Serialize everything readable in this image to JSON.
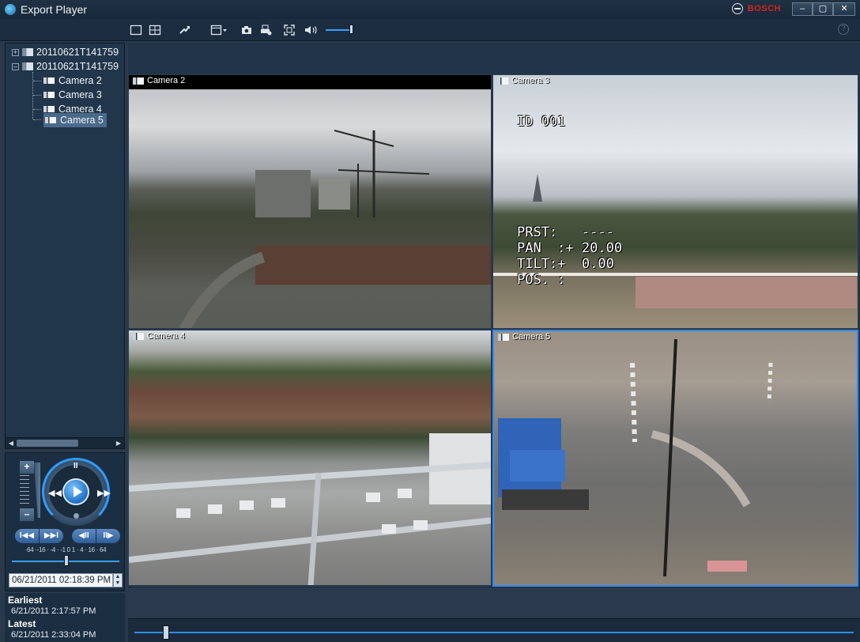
{
  "window": {
    "title": "Export Player",
    "brand": "BOSCH",
    "minimize": "–",
    "maximize": "▢",
    "close": "✕"
  },
  "colors": {
    "accent": "#2f8bff",
    "brand_red": "#d8241f",
    "panel": "#22364b",
    "window_bg": "#2a3a4c"
  },
  "toolbar": {
    "icons": [
      "single-view-icon",
      "quad-view-icon",
      "export-icon",
      "display-options-icon",
      "snapshot-icon",
      "print-icon",
      "fullscreen-icon",
      "speaker-icon"
    ],
    "volume_level": 0.9,
    "help": "?"
  },
  "tree": {
    "recordings": [
      {
        "label": "20110621T141759",
        "expanded": false
      },
      {
        "label": "20110621T141759",
        "expanded": true
      }
    ],
    "cameras": [
      "Camera 2",
      "Camera 3",
      "Camera 4",
      "Camera 5"
    ],
    "selected": "Camera 5",
    "collapsed_sign": "+",
    "expanded_sign": "–"
  },
  "playback": {
    "speed_plus": "+",
    "speed_minus": "–",
    "pause": "II",
    "rewind": "◀◀",
    "forward": "▶▶",
    "skip_back": "I◀◀",
    "skip_forward": "▶▶I",
    "step_back": "◀II",
    "step_forward": "II▶",
    "speed_scale": "·64 ·-16 · -4 · -1 0 1 · 4 · 16 · 64",
    "speed_position": 0.5,
    "datetime": "06/21/2011 02:18:39 PM"
  },
  "range": {
    "earliest_label": "Earliest",
    "earliest_value": "6/21/2011 2:17:57 PM",
    "latest_label": "Latest",
    "latest_value": "6/21/2011 2:33:04 PM"
  },
  "tiles": {
    "camera_2": "Camera 2",
    "camera_3": "Camera 3",
    "camera_4": "Camera 4",
    "camera_5": "Camera 5",
    "active": "Camera 5"
  },
  "osd": {
    "id": "ID 001",
    "prst": "PRST:   ----",
    "pan": "PAN  :+ 20.00",
    "tilt": "TILT:+  0.00",
    "pos": "POS. :"
  },
  "timeline": {
    "position": 0.04
  }
}
